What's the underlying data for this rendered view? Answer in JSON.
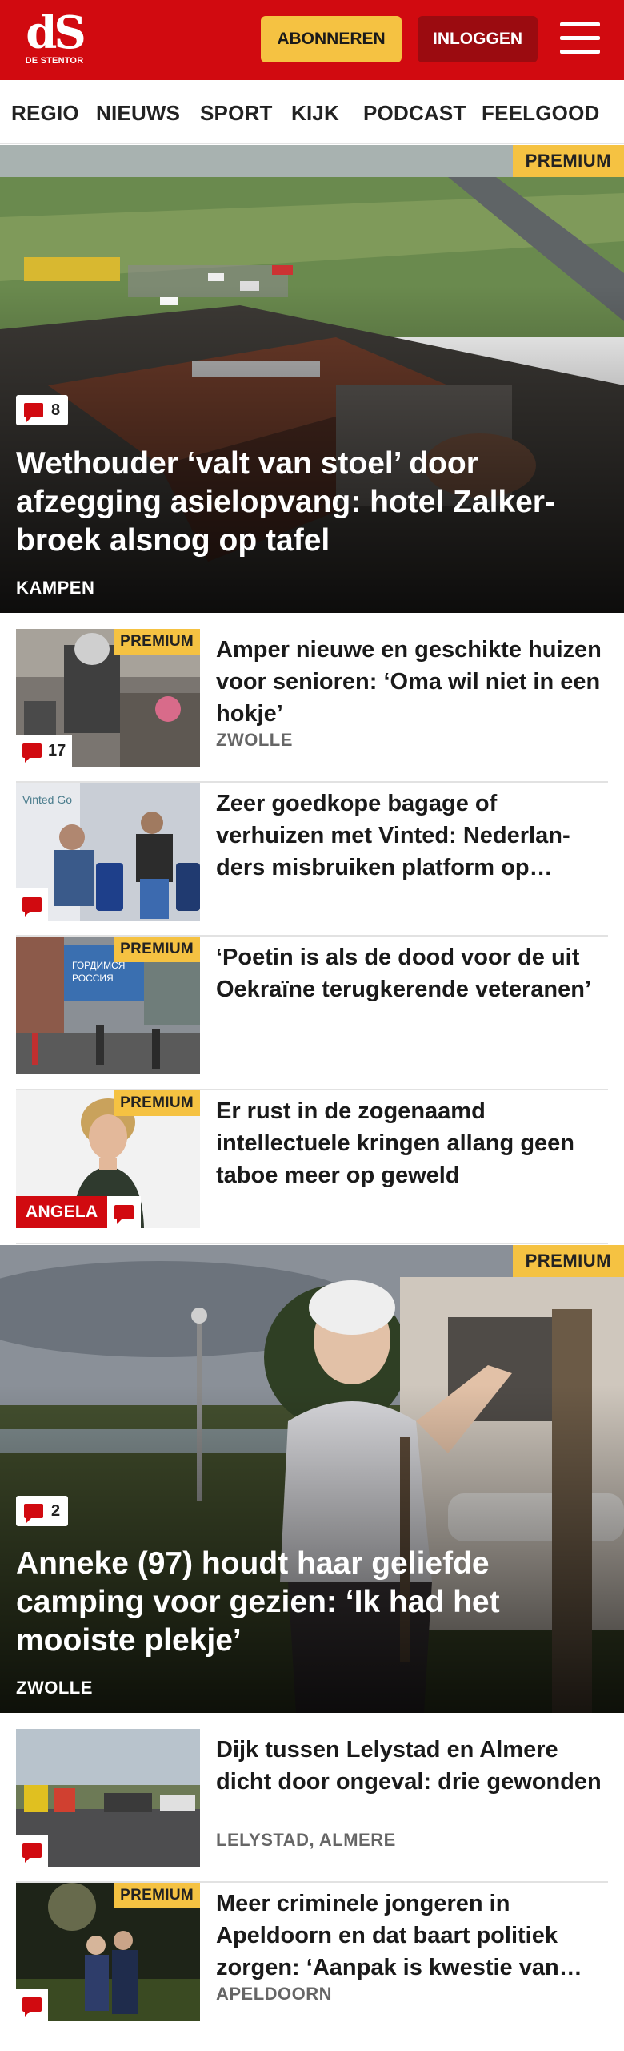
{
  "header": {
    "logo_mark": "dS",
    "logo_text": "DE STENTOR",
    "subscribe_label": "ABONNEREN",
    "login_label": "INLOGGEN",
    "menu_icon": "hamburger-icon",
    "brand_color": "#d10a10",
    "subscribe_color": "#f5c242"
  },
  "nav": {
    "items": [
      "REGIO",
      "NIEUWS",
      "SPORT",
      "KIJK",
      "PODCAST",
      "FEELGOOD"
    ]
  },
  "hero1": {
    "premium": "PREMIUM",
    "comments": "8",
    "title": "Wethouder ‘valt van stoel’ door afzegging asielopvang: hotel Zalker­broek alsnog op tafel",
    "location": "KAMPEN"
  },
  "list1": [
    {
      "premium": "PREMIUM",
      "comments": "17",
      "title": "Amper nieuwe en geschikte huizen voor senioren: ‘Oma wil niet in een hokje’",
      "location": "ZWOLLE"
    },
    {
      "premium": "",
      "comments": "",
      "title": "Zeer goedkope bagage of verhuizen met Vinted: Nederlan­ders misbruiken platform op…",
      "location": ""
    },
    {
      "premium": "PREMIUM",
      "comments": "",
      "title": "‘Poetin is als de dood voor de uit Oekraïne terugkerende veteranen’",
      "location": ""
    },
    {
      "premium": "PREMIUM",
      "author": "ANGELA",
      "comments": "",
      "title": "Er rust in de zogenaamd intellectuele kringen allang geen taboe meer op geweld",
      "location": ""
    }
  ],
  "hero2": {
    "premium": "PREMIUM",
    "comments": "2",
    "title": "Anneke (97) houdt haar geliefde camping voor gezien: ‘Ik had het mooiste plekje’",
    "location": "ZWOLLE"
  },
  "list2": [
    {
      "premium": "",
      "comments": "",
      "title": "Dijk tussen Lelystad en Almere dicht door ongeval: drie gewonden",
      "location": "LELYSTAD, ALMERE"
    },
    {
      "premium": "PREMIUM",
      "comments": "",
      "title": "Meer criminele jongeren in Apeldoorn en dat baart politiek zorgen: ‘Aanpak is kwestie van…",
      "location": "APELDOORN"
    }
  ]
}
